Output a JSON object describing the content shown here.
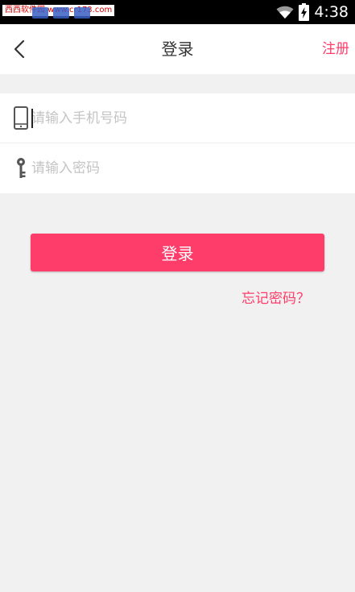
{
  "status_bar": {
    "watermark": "西西软件园 www.cr173.com",
    "time": "4:38"
  },
  "header": {
    "title": "登录",
    "register": "注册"
  },
  "form": {
    "phone_placeholder": "请输入手机号码",
    "password_placeholder": "请输入密码"
  },
  "actions": {
    "login": "登录",
    "forgot_password": "忘记密码？"
  },
  "colors": {
    "accent": "#ff3d6a",
    "background": "#f1f1f1"
  }
}
